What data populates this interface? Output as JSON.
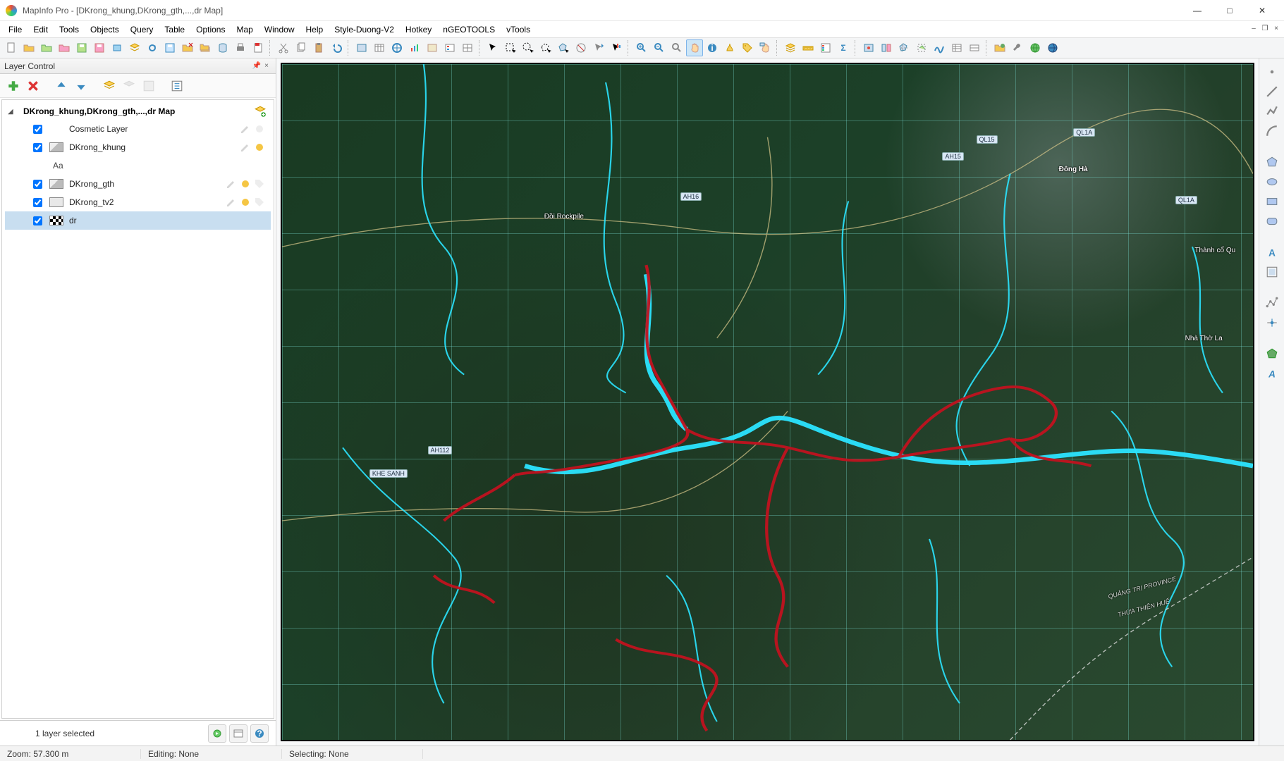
{
  "app_title": "MapInfo Pro - [DKrong_khung,DKrong_gth,...,dr Map]",
  "window_controls": {
    "min": "—",
    "max": "□",
    "close": "✕"
  },
  "mdi_controls": {
    "min": "–",
    "restore": "❐",
    "close": "×"
  },
  "menu": [
    "File",
    "Edit",
    "Tools",
    "Objects",
    "Query",
    "Table",
    "Options",
    "Map",
    "Window",
    "Help",
    "Style-Duong-V2",
    "Hotkey",
    "nGEOTOOLS",
    "vTools"
  ],
  "layer_panel": {
    "title": "Layer Control",
    "map_title": "DKrong_khung,DKrong_gth,...,dr Map",
    "layers": [
      {
        "checked": true,
        "swatch": "none",
        "name": "Cosmetic Layer",
        "icons": [
          "edit",
          "style"
        ]
      },
      {
        "checked": true,
        "swatch": "poly",
        "name": "DKrong_khung",
        "icons": [
          "edit",
          "style-gold"
        ]
      },
      {
        "aa": "Aa"
      },
      {
        "checked": true,
        "swatch": "poly",
        "name": "DKrong_gth",
        "icons": [
          "edit",
          "style-gold",
          "tag"
        ]
      },
      {
        "checked": true,
        "swatch": "rect",
        "name": "DKrong_tv2",
        "icons": [
          "edit",
          "style-gold",
          "tag"
        ]
      },
      {
        "checked": true,
        "swatch": "checker",
        "name": "dr",
        "icons": [],
        "selected": true
      }
    ],
    "footer_text": "1 layer selected"
  },
  "map_labels": {
    "rockpile": "Đồi Rockpile",
    "dongha": "Đông Hà",
    "thanhco": "Thành cổ Qu",
    "nhatho": "Nhà Thờ La",
    "province1": "QUẢNG TRỊ PROVINCE",
    "province2": "THỪA THIÊN HUẾ",
    "r_ql1a": "QL1A",
    "r_ql15": "QL15",
    "r_ah15": "AH15",
    "r_ah16": "AH16",
    "r_ah112": "AH112",
    "r_khesanh": "KHE SANH"
  },
  "status": {
    "zoom": "Zoom: 57.300 m",
    "editing": "Editing: None",
    "selecting": "Selecting: None"
  }
}
